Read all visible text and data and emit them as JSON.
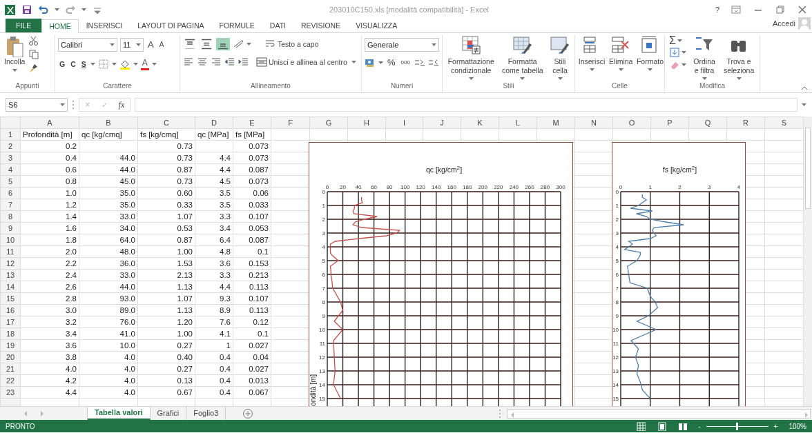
{
  "window": {
    "title": "203010C150.xls  [modalità compatibilità] - Excel",
    "help": "?"
  },
  "account": {
    "label": "Accedi"
  },
  "ribbon_tabs": [
    {
      "label": "FILE",
      "kind": "file",
      "selected": false
    },
    {
      "label": "HOME",
      "kind": "tab",
      "selected": true
    },
    {
      "label": "INSERISCI",
      "kind": "tab",
      "selected": false
    },
    {
      "label": "LAYOUT DI PAGINA",
      "kind": "tab",
      "selected": false
    },
    {
      "label": "FORMULE",
      "kind": "tab",
      "selected": false
    },
    {
      "label": "DATI",
      "kind": "tab",
      "selected": false
    },
    {
      "label": "REVISIONE",
      "kind": "tab",
      "selected": false
    },
    {
      "label": "VISUALIZZA",
      "kind": "tab",
      "selected": false
    }
  ],
  "ribbon": {
    "clipboard": {
      "paste": "Incolla",
      "group": "Appunti"
    },
    "font": {
      "name": "Calibri",
      "size": "11",
      "grow": "A",
      "shrink": "A",
      "bold": "G",
      "italic": "C",
      "underline": "S",
      "color_button": "A",
      "group": "Carattere"
    },
    "alignment": {
      "vertical": [
        {
          "kind": "top",
          "selected": false
        },
        {
          "kind": "middle",
          "selected": false
        },
        {
          "kind": "bottom",
          "selected": true
        }
      ],
      "wrap": "Testo a capo",
      "merge": "Unisci e allinea al centro",
      "group": "Allineamento"
    },
    "number": {
      "format": "Generale",
      "percent": "%",
      "thousands": "000",
      "group": "Numeri"
    },
    "styles": {
      "buttons": [
        {
          "label": "Formattazione condizionale",
          "kind": "conditional"
        },
        {
          "label": "Formatta come tabella",
          "kind": "table"
        },
        {
          "label": "Stili cella",
          "kind": "cellstyle"
        }
      ],
      "group": "Stili"
    },
    "cells": {
      "buttons": [
        {
          "label": "Inserisci",
          "kind": "insert"
        },
        {
          "label": "Elimina",
          "kind": "delete"
        },
        {
          "label": "Formato",
          "kind": "format"
        }
      ],
      "group": "Celle"
    },
    "editing": {
      "sum": "Σ",
      "buttons": [
        {
          "label": "Ordina e filtra",
          "kind": "sort"
        },
        {
          "label": "Trova e seleziona",
          "kind": "find"
        }
      ],
      "group": "Modifica"
    }
  },
  "formula_bar": {
    "name_box": "S6",
    "cancel": "×",
    "enter": "✓",
    "function": "fx"
  },
  "sheet": {
    "columns": [
      "A",
      "B",
      "C",
      "D",
      "E",
      "F",
      "G",
      "H",
      "I",
      "J",
      "K",
      "L",
      "M",
      "N",
      "O",
      "P",
      "Q",
      "R",
      "S"
    ],
    "rows": [
      {
        "number": "1",
        "kind": "header",
        "cells": [
          "Profondità [m]",
          "qc [kg/cmq]",
          "fs [kg/cmq]",
          "qc [MPa]",
          "fs [MPa]"
        ]
      },
      {
        "number": "2",
        "kind": "data",
        "cells": [
          "0.2",
          null,
          "0.73",
          null,
          "0.073"
        ]
      },
      {
        "number": "3",
        "kind": "data",
        "cells": [
          "0.4",
          "44.0",
          "0.73",
          "4.4",
          "0.073"
        ]
      },
      {
        "number": "4",
        "kind": "data",
        "cells": [
          "0.6",
          "44.0",
          "0.87",
          "4.4",
          "0.087"
        ]
      },
      {
        "number": "5",
        "kind": "data",
        "cells": [
          "0.8",
          "45.0",
          "0.73",
          "4.5",
          "0.073"
        ]
      },
      {
        "number": "6",
        "kind": "data",
        "cells": [
          "1.0",
          "35.0",
          "0.60",
          "3.5",
          "0.06"
        ]
      },
      {
        "number": "7",
        "kind": "data",
        "cells": [
          "1.2",
          "35.0",
          "0.33",
          "3.5",
          "0.033"
        ]
      },
      {
        "number": "8",
        "kind": "data",
        "cells": [
          "1.4",
          "33.0",
          "1.07",
          "3.3",
          "0.107"
        ]
      },
      {
        "number": "9",
        "kind": "data",
        "cells": [
          "1.6",
          "34.0",
          "0.53",
          "3.4",
          "0.053"
        ]
      },
      {
        "number": "10",
        "kind": "data",
        "cells": [
          "1.8",
          "64.0",
          "0.87",
          "6.4",
          "0.087"
        ]
      },
      {
        "number": "11",
        "kind": "data",
        "cells": [
          "2.0",
          "48.0",
          "1.00",
          "4.8",
          "0.1"
        ]
      },
      {
        "number": "12",
        "kind": "data",
        "cells": [
          "2.2",
          "36.0",
          "1.53",
          "3.6",
          "0.153"
        ]
      },
      {
        "number": "13",
        "kind": "data",
        "cells": [
          "2.4",
          "33.0",
          "2.13",
          "3.3",
          "0.213"
        ]
      },
      {
        "number": "14",
        "kind": "data",
        "cells": [
          "2.6",
          "44.0",
          "1.13",
          "4.4",
          "0.113"
        ]
      },
      {
        "number": "15",
        "kind": "data",
        "cells": [
          "2.8",
          "93.0",
          "1.07",
          "9.3",
          "0.107"
        ]
      },
      {
        "number": "16",
        "kind": "data",
        "cells": [
          "3.0",
          "89.0",
          "1.13",
          "8.9",
          "0.113"
        ]
      },
      {
        "number": "17",
        "kind": "data",
        "cells": [
          "3.2",
          "76.0",
          "1.20",
          "7.6",
          "0.12"
        ]
      },
      {
        "number": "18",
        "kind": "data",
        "cells": [
          "3.4",
          "41.0",
          "1.00",
          "4.1",
          "0.1"
        ]
      },
      {
        "number": "19",
        "kind": "data",
        "cells": [
          "3.6",
          "10.0",
          "0.27",
          "1",
          "0.027"
        ]
      },
      {
        "number": "20",
        "kind": "data",
        "cells": [
          "3.8",
          "4.0",
          "0.40",
          "0.4",
          "0.04"
        ]
      },
      {
        "number": "21",
        "kind": "data",
        "cells": [
          "4.0",
          "4.0",
          "0.27",
          "0.4",
          "0.027"
        ]
      },
      {
        "number": "22",
        "kind": "data",
        "cells": [
          "4.2",
          "4.0",
          "0.13",
          "0.4",
          "0.013"
        ]
      },
      {
        "number": "23",
        "kind": "data",
        "cells": [
          "4.4",
          "4.0",
          "0.67",
          "0.4",
          "0.067"
        ]
      }
    ],
    "charts": [
      {
        "chart_data": {
          "type": "line",
          "grid": true,
          "title": "qc [kg/cm$^{2}$]",
          "ylabel": "ondità [m]",
          "x": [
            44,
            44,
            45,
            35,
            35,
            33,
            34,
            64,
            48,
            36,
            33,
            44,
            93,
            89,
            76,
            41,
            10,
            4,
            4,
            4,
            4,
            6,
            14,
            4,
            5,
            7,
            17,
            20,
            9,
            20,
            8,
            9,
            10,
            8,
            17
          ],
          "series": [
            {
              "color": "#c0504d",
              "values": [
                0.4,
                0.6,
                0.8,
                1.0,
                1.2,
                1.4,
                1.6,
                1.8,
                2.0,
                2.2,
                2.4,
                2.6,
                2.8,
                3.0,
                3.2,
                3.4,
                3.6,
                3.8,
                4.0,
                4.2,
                4.4,
                4.6,
                5.0,
                5.4,
                6.0,
                7.0,
                8.0,
                8.6,
                9.4,
                10.0,
                10.8,
                12.0,
                13.0,
                14.0,
                15.0
              ]
            }
          ],
          "xlim": [
            0,
            300
          ],
          "xticks": [
            0,
            20,
            40,
            60,
            80,
            100,
            120,
            140,
            160,
            180,
            200,
            220,
            240,
            260,
            280,
            300
          ],
          "ylim": [
            16,
            0
          ],
          "yticks": [
            0,
            1,
            2,
            3,
            4,
            5,
            6,
            7,
            8,
            9,
            10,
            11,
            12,
            13,
            14,
            15
          ]
        }
      },
      {
        "chart_data": {
          "type": "line",
          "grid": true,
          "title": "fs [kg/cm$^{2}$]",
          "x": [
            0.73,
            0.73,
            0.87,
            0.73,
            0.6,
            0.33,
            1.07,
            0.53,
            0.87,
            1.0,
            1.53,
            2.13,
            1.13,
            1.07,
            1.13,
            1.2,
            1.0,
            0.27,
            0.4,
            0.27,
            0.13,
            0.67,
            0.66,
            0.55,
            0.23,
            0.27,
            0.31,
            0.9,
            1.0,
            1.17,
            1.25,
            0.94,
            0.55,
            1.2,
            0.35,
            0.6,
            0.5,
            0.6,
            0.55,
            0.66,
            0.74,
            1.0
          ],
          "series": [
            {
              "color": "#4f7fa8",
              "values": [
                0.2,
                0.4,
                0.6,
                0.8,
                1.0,
                1.2,
                1.4,
                1.6,
                1.8,
                2.0,
                2.2,
                2.4,
                2.6,
                2.8,
                3.0,
                3.2,
                3.4,
                3.6,
                3.8,
                4.0,
                4.2,
                4.4,
                4.6,
                5.0,
                5.4,
                6.0,
                6.6,
                7.0,
                7.6,
                8.0,
                8.4,
                9.0,
                9.4,
                10.0,
                10.8,
                11.4,
                12.0,
                12.6,
                13.2,
                13.8,
                14.4,
                15.0
              ]
            }
          ],
          "xlim": [
            0,
            4
          ],
          "xticks": [
            0,
            1,
            2,
            3,
            4
          ],
          "ylim": [
            16,
            0
          ],
          "yticks": [
            0,
            1,
            2,
            3,
            4,
            5,
            6,
            7,
            8,
            9,
            10,
            11,
            12,
            13,
            14,
            15
          ]
        }
      }
    ]
  },
  "sheet_tabs": [
    {
      "label": "Tabella valori",
      "selected": true
    },
    {
      "label": "Grafici",
      "selected": false
    },
    {
      "label": "Foglio3",
      "selected": false
    }
  ],
  "status_bar": {
    "text": "PRONTO",
    "zoom": {
      "out": "-",
      "in": "+",
      "level": 0.5,
      "value": "100%"
    }
  }
}
